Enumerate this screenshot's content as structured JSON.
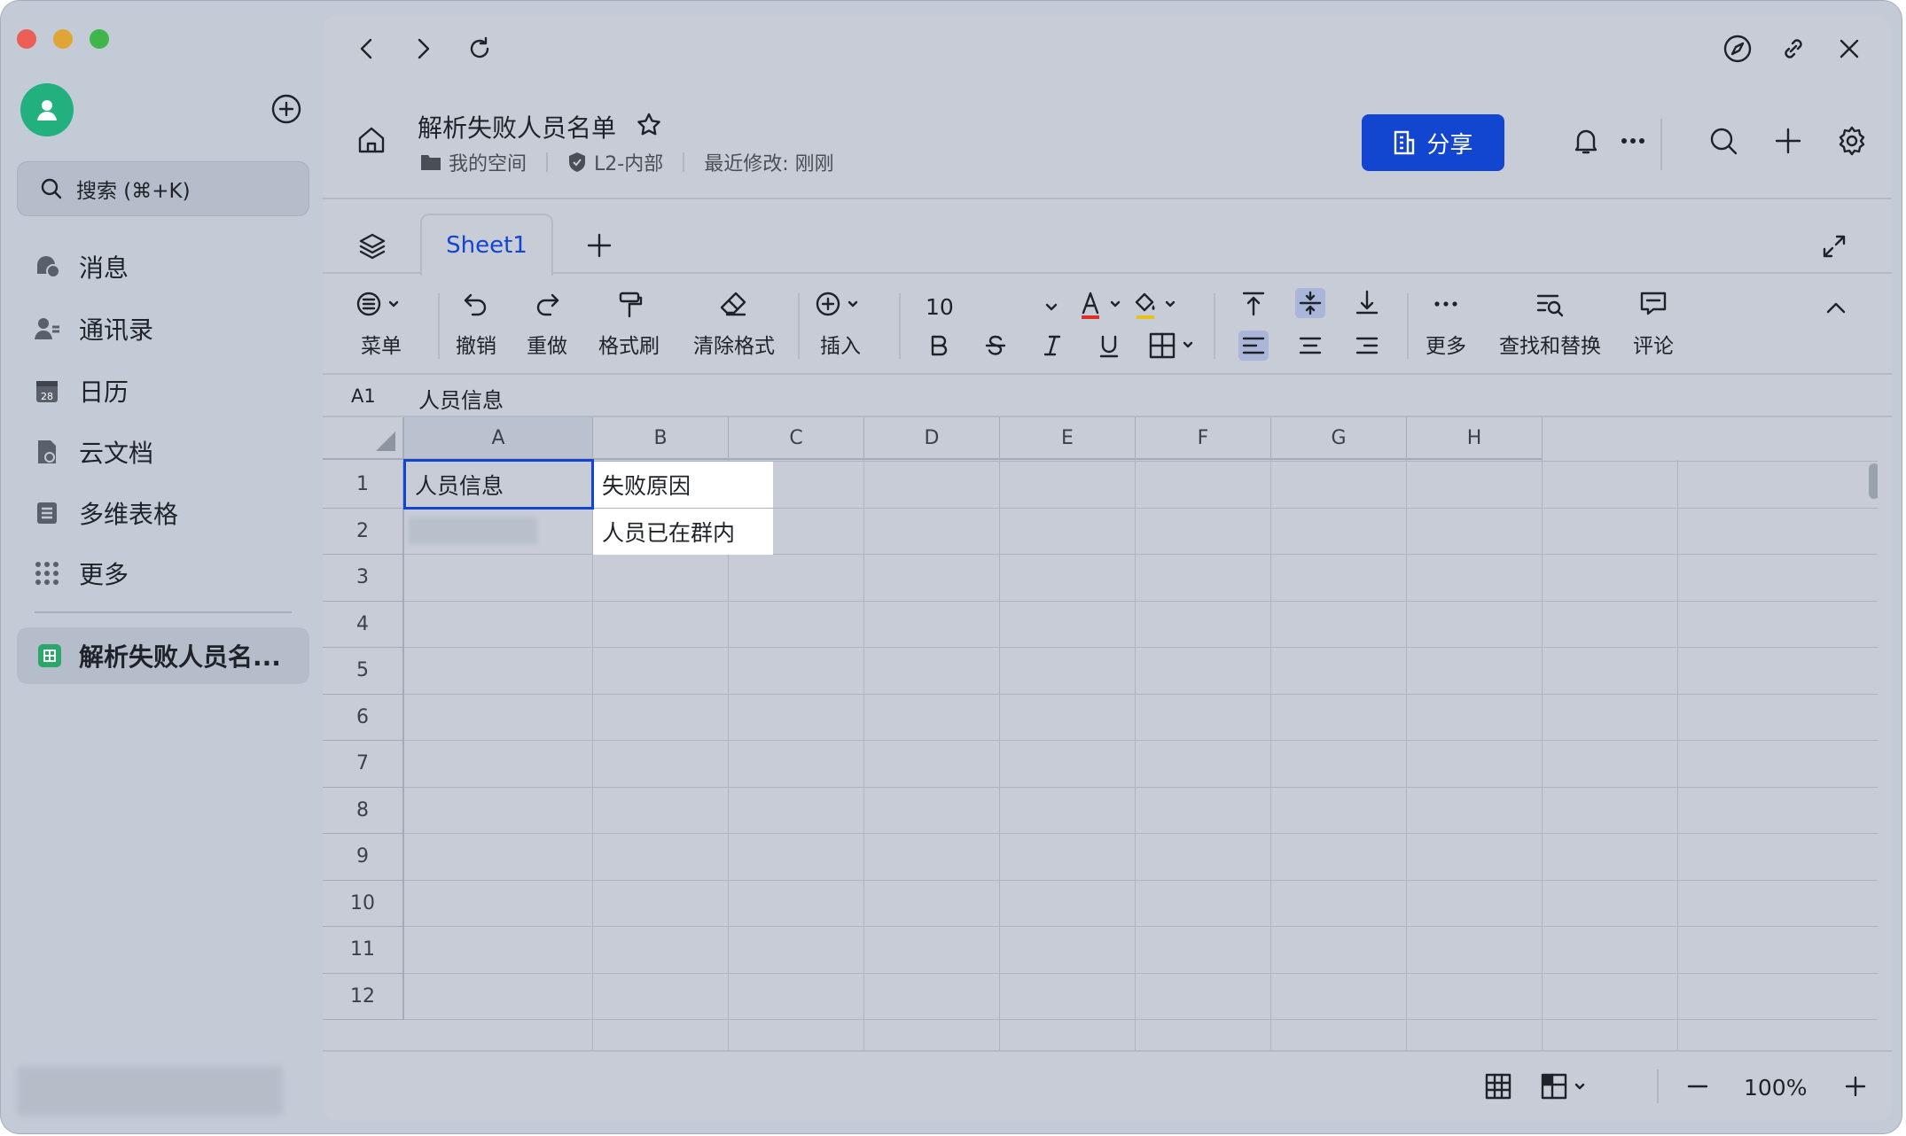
{
  "window": {
    "traffic_lights": {
      "close_color": "#ec5f57",
      "minimize_color": "#e0a534",
      "zoom_color": "#3fb54a"
    }
  },
  "sidebar": {
    "search_label": "搜索 (⌘+K)",
    "items": [
      {
        "label": "消息",
        "icon": "chat-icon"
      },
      {
        "label": "通讯录",
        "icon": "contacts-icon"
      },
      {
        "label": "日历",
        "icon": "calendar-icon"
      },
      {
        "label": "云文档",
        "icon": "cloud-doc-icon"
      },
      {
        "label": "多维表格",
        "icon": "base-table-icon"
      },
      {
        "label": "更多",
        "icon": "more-grid-icon"
      }
    ],
    "calendar_day": "28",
    "active_doc": "解析失败人员名..."
  },
  "header": {
    "title": "解析失败人员名单",
    "location": "我的空间",
    "security_label": "L2-内部",
    "modified": "最近修改: 刚刚",
    "share_label": "分享"
  },
  "tabs": {
    "sheets": [
      "Sheet1"
    ]
  },
  "toolbar": {
    "menu": "菜单",
    "undo": "撤销",
    "redo": "重做",
    "format_painter": "格式刷",
    "clear_format": "清除格式",
    "insert": "插入",
    "font_size": "10",
    "more": "更多",
    "find_replace": "查找和替换",
    "comment": "评论",
    "text_color": "#d9312a",
    "fill_color": "#e8c21a"
  },
  "formula_bar": {
    "cell_ref": "A1",
    "value": "人员信息"
  },
  "grid": {
    "columns": [
      "A",
      "B",
      "C",
      "D",
      "E",
      "F",
      "G",
      "H"
    ],
    "rows": [
      "1",
      "2",
      "3",
      "4",
      "5",
      "6",
      "7",
      "8",
      "9",
      "10",
      "11",
      "12"
    ],
    "cells": {
      "A1": "人员信息",
      "B1": "失败原因",
      "B2": "人员已在群内"
    }
  },
  "status_bar": {
    "zoom": "100%"
  }
}
